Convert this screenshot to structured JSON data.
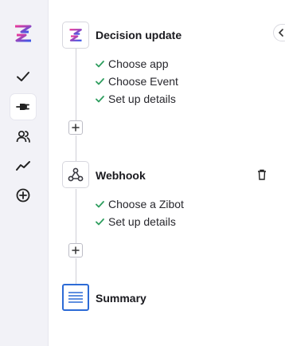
{
  "colors": {
    "accent": "#2d6bd6",
    "check": "#2f9e5f",
    "sidebar_bg": "#f2f2f7",
    "logo_pink": "#e8399a",
    "logo_blue": "#3a57e8"
  },
  "sidebar": {
    "items": [
      {
        "icon": "check-icon",
        "active": false
      },
      {
        "icon": "plug-icon",
        "active": true
      },
      {
        "icon": "users-icon",
        "active": false
      },
      {
        "icon": "activity-icon",
        "active": false
      },
      {
        "icon": "plus-circle-icon",
        "active": false
      }
    ]
  },
  "steps": [
    {
      "title": "Decision update",
      "icon": "zibot-logo-icon",
      "substeps": [
        "Choose app",
        "Choose Event",
        "Set up details"
      ]
    },
    {
      "title": "Webhook",
      "icon": "webhook-icon",
      "substeps": [
        "Choose a Zibot",
        "Set up details"
      ]
    },
    {
      "title": "Summary",
      "icon": "summary-icon",
      "substeps": []
    }
  ]
}
